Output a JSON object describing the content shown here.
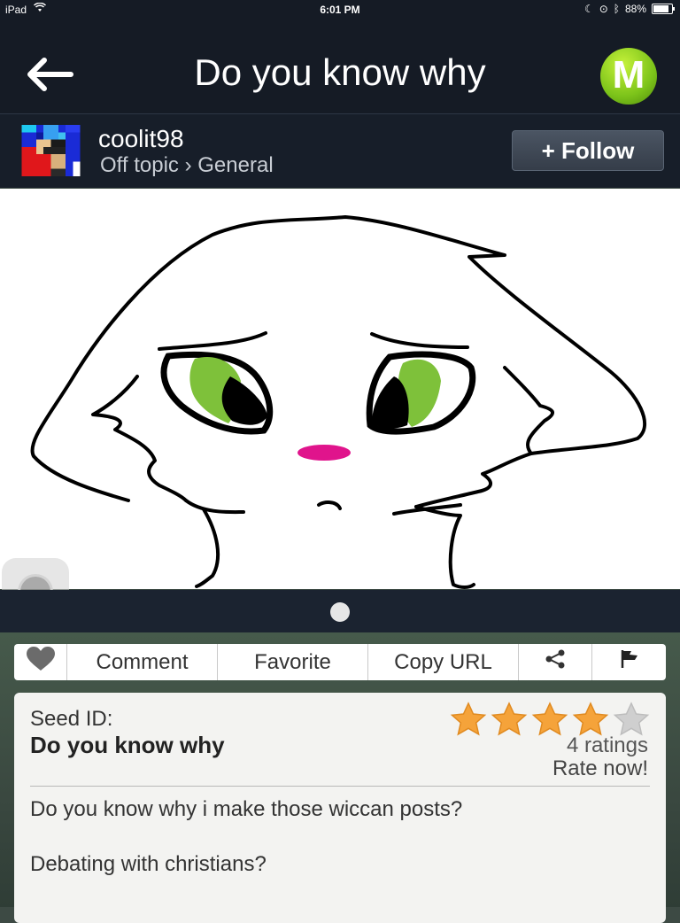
{
  "status_bar": {
    "carrier": "iPad",
    "time": "6:01 PM",
    "battery": "88%",
    "battery_level": 0.88
  },
  "nav": {
    "title": "Do you know why",
    "logo_letter": "M"
  },
  "author": {
    "username": "coolit98",
    "breadcrumb": "Off topic › General",
    "follow_label": "+ Follow"
  },
  "actions": {
    "comment": "Comment",
    "favorite": "Favorite",
    "copy_url": "Copy URL"
  },
  "seed": {
    "label": "Seed ID:",
    "name": "Do you know why",
    "rating_stars": 4,
    "rating_max": 5,
    "ratings_count": "4 ratings",
    "rate_now": "Rate now!",
    "description_lines": [
      "Do you know why i make those wiccan posts?",
      "Debating with christians?"
    ]
  },
  "colors": {
    "star_filled": "#f5a33a",
    "star_empty": "#cfcfcf",
    "eye_green": "#7ec13a",
    "mouth_pink": "#e0148c"
  }
}
